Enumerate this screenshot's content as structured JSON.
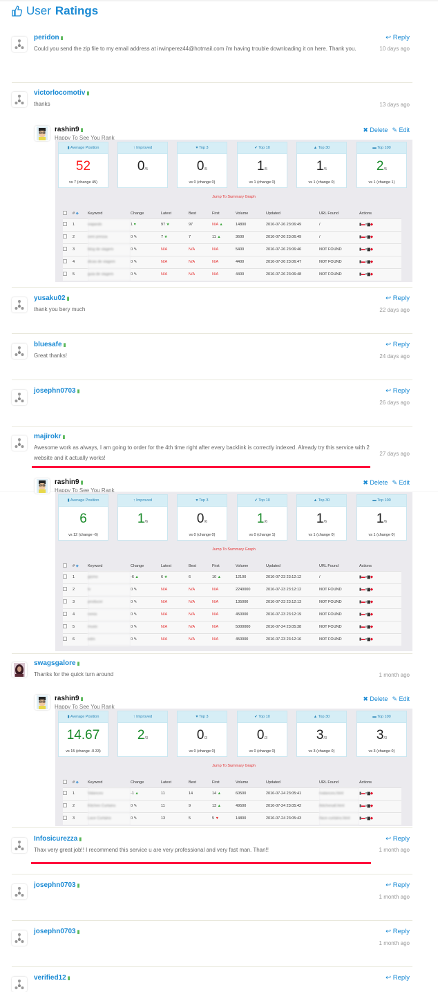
{
  "header": {
    "title_light": "User",
    "title_bold": "Ratings",
    "icon": "thumbs-up-icon"
  },
  "labels": {
    "reply": "Reply",
    "delete": "Delete",
    "edit": "Edit"
  },
  "colors": {
    "accent": "#1a8ad4",
    "thumb": "#5cb85c",
    "highlight": "#ff003c",
    "red": "#e53030",
    "green": "#1a8a2a"
  },
  "comments": [
    {
      "user": "peridon",
      "avatar": "default",
      "text": "Could you send the zip file to my email address at irwinperez44@hotmail.com i'm having trouble downloading it on here. Thank you.",
      "time": "10 days ago",
      "reply_link": true
    },
    {
      "user": "victorlocomotiv",
      "avatar": "default",
      "text": "thanks",
      "time": "13 days ago",
      "reply_link": false,
      "reply": {
        "user": "rashin9",
        "text": "Happy To See You Rank",
        "panel": 0
      }
    },
    {
      "user": "yusaku02",
      "avatar": "default",
      "text": "thank you bery much",
      "time": "22 days ago",
      "reply_link": true
    },
    {
      "user": "bluesafe",
      "avatar": "default",
      "text": "Great thanks!",
      "time": "24 days ago",
      "reply_link": true
    },
    {
      "user": "josephn0703",
      "avatar": "default",
      "text": "",
      "time": "26 days ago",
      "reply_link": true
    },
    {
      "user": "majirokr",
      "avatar": "default",
      "text": "Awesome work as always, I am going to order for the 4th time right after every backlink is correctly indexed. Already try this service with 2 website and it actually works!",
      "time": "27 days ago",
      "reply_link": false,
      "highlighted": true,
      "reply": {
        "user": "rashin9",
        "text": "Happy To See You Rank",
        "panel": 1
      }
    },
    {
      "user": "swagsgalore",
      "avatar": "photo",
      "text": "Thanks for the quick turn around",
      "time": "1 month ago",
      "reply_link": false,
      "reply": {
        "user": "rashin9",
        "text": "Happy To See You Rank",
        "panel": 2
      }
    },
    {
      "user": "Infosicurezza",
      "avatar": "default",
      "text": "Thax very great job!! I recommend this service u are very professional and very fast man. Than!!",
      "time": "1 month ago",
      "reply_link": true,
      "highlighted": true
    },
    {
      "user": "josephn0703",
      "avatar": "default",
      "text": "",
      "time": "1 month ago",
      "reply_link": true
    },
    {
      "user": "josephn0703",
      "avatar": "default",
      "text": "",
      "time": "1 month ago",
      "reply_link": true
    },
    {
      "user": "verified12",
      "avatar": "default",
      "text": "",
      "time": "",
      "reply_link": true
    }
  ],
  "panels": [
    {
      "jump": "Jump To Summary Graph",
      "cards": [
        {
          "label": "Average Position",
          "icon": "bar-chart-icon",
          "value": "52",
          "total": "",
          "sub": "vs 7 (change 45)",
          "color": "#ff1a1a"
        },
        {
          "label": "Improved",
          "icon": "arrow-up-icon",
          "value": "0",
          "total": "/5",
          "sub": "",
          "color": "#222"
        },
        {
          "label": "Top 3",
          "icon": "heart-icon",
          "value": "0",
          "total": "/5",
          "sub": "vs 0 (change 0)",
          "color": "#222"
        },
        {
          "label": "Top 10",
          "icon": "check-icon",
          "value": "1",
          "total": "/5",
          "sub": "vs 1 (change 0)",
          "color": "#222"
        },
        {
          "label": "Top 30",
          "icon": "road-icon",
          "value": "1",
          "total": "/5",
          "sub": "vs 1 (change 0)",
          "color": "#222"
        },
        {
          "label": "Top 100",
          "icon": "briefcase-icon",
          "value": "2",
          "total": "/5",
          "sub": "vs 1 (change 1)",
          "color": "#1a8a2a"
        }
      ],
      "headers": [
        "#",
        "Keyword",
        "Change",
        "Latest",
        "Best",
        "First",
        "Volume",
        "Updated",
        "URL Found",
        "Actions"
      ],
      "rows": [
        {
          "num": "1",
          "keyword": "viajando",
          "change": "1",
          "change_icon": "heart",
          "latest": "97",
          "latest_icon": "star",
          "best": "97",
          "first": "N/A",
          "first_icon": "thumbs-up",
          "volume": "14800",
          "updated": "2016-07-26 23:06:49",
          "url": "/"
        },
        {
          "num": "2",
          "keyword": "sem pressa",
          "change": "0",
          "change_icon": "pin",
          "latest": "7",
          "latest_icon": "star",
          "best": "7",
          "first": "11",
          "first_icon": "thumbs-up",
          "volume": "3600",
          "updated": "2016-07-26 23:06:49",
          "url": "/"
        },
        {
          "num": "3",
          "keyword": "blog de viagem",
          "change": "0",
          "change_icon": "pin",
          "latest": "N/A",
          "latest_icon": "",
          "best": "N/A",
          "first": "N/A",
          "first_icon": "",
          "volume": "5400",
          "updated": "2016-07-26 23:06:46",
          "url": "NOT FOUND"
        },
        {
          "num": "4",
          "keyword": "dicas de viagem",
          "change": "0",
          "change_icon": "pin",
          "latest": "N/A",
          "latest_icon": "",
          "best": "N/A",
          "first": "N/A",
          "first_icon": "",
          "volume": "4400",
          "updated": "2016-07-26 23:06:47",
          "url": "NOT FOUND"
        },
        {
          "num": "5",
          "keyword": "guia de viagem",
          "change": "0",
          "change_icon": "pin",
          "latest": "N/A",
          "latest_icon": "",
          "best": "N/A",
          "first": "N/A",
          "first_icon": "",
          "volume": "4400",
          "updated": "2016-07-26 23:06:48",
          "url": "NOT FOUND"
        }
      ]
    },
    {
      "jump": "Jump To Summary Graph",
      "cards": [
        {
          "label": "Average Position",
          "icon": "bar-chart-icon",
          "value": "6",
          "total": "",
          "sub": "vs 12 (change -6)",
          "color": "#1a8a2a"
        },
        {
          "label": "Improved",
          "icon": "arrow-up-icon",
          "value": "1",
          "total": "/6",
          "sub": "",
          "color": "#1a8a2a"
        },
        {
          "label": "Top 3",
          "icon": "heart-icon",
          "value": "0",
          "total": "/6",
          "sub": "vs 0 (change 0)",
          "color": "#222"
        },
        {
          "label": "Top 10",
          "icon": "check-icon",
          "value": "1",
          "total": "/6",
          "sub": "vs 0 (change 1)",
          "color": "#1a8a2a"
        },
        {
          "label": "Top 30",
          "icon": "road-icon",
          "value": "1",
          "total": "/6",
          "sub": "vs 1 (change 0)",
          "color": "#222"
        },
        {
          "label": "Top 100",
          "icon": "briefcase-icon",
          "value": "1",
          "total": "/6",
          "sub": "vs 1 (change 0)",
          "color": "#222"
        }
      ],
      "headers": [
        "#",
        "Keyword",
        "Change",
        "Latest",
        "Best",
        "First",
        "Volume",
        "Updated",
        "URL Found",
        "Actions"
      ],
      "rows": [
        {
          "num": "1",
          "keyword": "gizmo",
          "change": "-6",
          "change_icon": "thumbs-up",
          "latest": "6",
          "latest_icon": "star",
          "best": "6",
          "first": "10",
          "first_icon": "thumbs-up",
          "volume": "12100",
          "updated": "2016-07-23 23:12:12",
          "url": "/"
        },
        {
          "num": "2",
          "keyword": "tv",
          "change": "0",
          "change_icon": "pin",
          "latest": "N/A",
          "latest_icon": "",
          "best": "N/A",
          "first": "N/A",
          "first_icon": "",
          "volume": "2240000",
          "updated": "2016-07-23 23:12:12",
          "url": "NOT FOUND"
        },
        {
          "num": "3",
          "keyword": "producer",
          "change": "0",
          "change_icon": "pin",
          "latest": "N/A",
          "latest_icon": "",
          "best": "N/A",
          "first": "N/A",
          "first_icon": "",
          "volume": "135000",
          "updated": "2016-07-23 23:12:13",
          "url": "NOT FOUND"
        },
        {
          "num": "4",
          "keyword": "remix",
          "change": "0",
          "change_icon": "pin",
          "latest": "N/A",
          "latest_icon": "",
          "best": "N/A",
          "first": "N/A",
          "first_icon": "",
          "volume": "450000",
          "updated": "2016-07-23 23:12:19",
          "url": "NOT FOUND"
        },
        {
          "num": "5",
          "keyword": "music",
          "change": "0",
          "change_icon": "pin",
          "latest": "N/A",
          "latest_icon": "",
          "best": "N/A",
          "first": "N/A",
          "first_icon": "",
          "volume": "5000000",
          "updated": "2016-07-24 23:05:38",
          "url": "NOT FOUND"
        },
        {
          "num": "6",
          "keyword": "edm",
          "change": "0",
          "change_icon": "pin",
          "latest": "N/A",
          "latest_icon": "",
          "best": "N/A",
          "first": "N/A",
          "first_icon": "",
          "volume": "450000",
          "updated": "2016-07-23 23:12:16",
          "url": "NOT FOUND"
        }
      ]
    },
    {
      "jump": "Jump To Summary Graph",
      "cards": [
        {
          "label": "Average Position",
          "icon": "bar-chart-icon",
          "value": "14.67",
          "total": "",
          "sub": "vs 15 (change -0.33)",
          "color": "#1a8a2a"
        },
        {
          "label": "Improved",
          "icon": "arrow-up-icon",
          "value": "2",
          "total": "/3",
          "sub": "",
          "color": "#1a8a2a"
        },
        {
          "label": "Top 3",
          "icon": "heart-icon",
          "value": "0",
          "total": "/3",
          "sub": "vs 0 (change 0)",
          "color": "#222"
        },
        {
          "label": "Top 10",
          "icon": "check-icon",
          "value": "0",
          "total": "/3",
          "sub": "vs 0 (change 0)",
          "color": "#222"
        },
        {
          "label": "Top 30",
          "icon": "road-icon",
          "value": "3",
          "total": "/3",
          "sub": "vs 3 (change 0)",
          "color": "#222"
        },
        {
          "label": "Top 100",
          "icon": "briefcase-icon",
          "value": "3",
          "total": "/3",
          "sub": "vs 3 (change 0)",
          "color": "#222"
        }
      ],
      "headers": [
        "#",
        "Keyword",
        "Change",
        "Latest",
        "Best",
        "First",
        "Volume",
        "Updated",
        "URL Found",
        "Actions"
      ],
      "rows": [
        {
          "num": "1",
          "keyword": "Valances",
          "change": "-1",
          "change_icon": "thumbs-up",
          "latest": "11",
          "latest_icon": "",
          "best": "14",
          "first": "14",
          "first_icon": "thumbs-up",
          "volume": "60500",
          "updated": "2016-07-24 23:05:41",
          "url": "/valances.html"
        },
        {
          "num": "2",
          "keyword": "Kitchen Curtains",
          "change": "0",
          "change_icon": "pin",
          "latest": "11",
          "latest_icon": "",
          "best": "9",
          "first": "13",
          "first_icon": "thumbs-up",
          "volume": "49500",
          "updated": "2016-07-24 23:05:42",
          "url": "/kitchenall.html"
        },
        {
          "num": "3",
          "keyword": "Lace Curtains",
          "change": "0",
          "change_icon": "pin",
          "latest": "13",
          "latest_icon": "",
          "best": "5",
          "first": "5",
          "first_icon": "thumbs-down",
          "volume": "14800",
          "updated": "2016-07-24 23:05:43",
          "url": "/lace-curtains.html"
        }
      ]
    }
  ]
}
